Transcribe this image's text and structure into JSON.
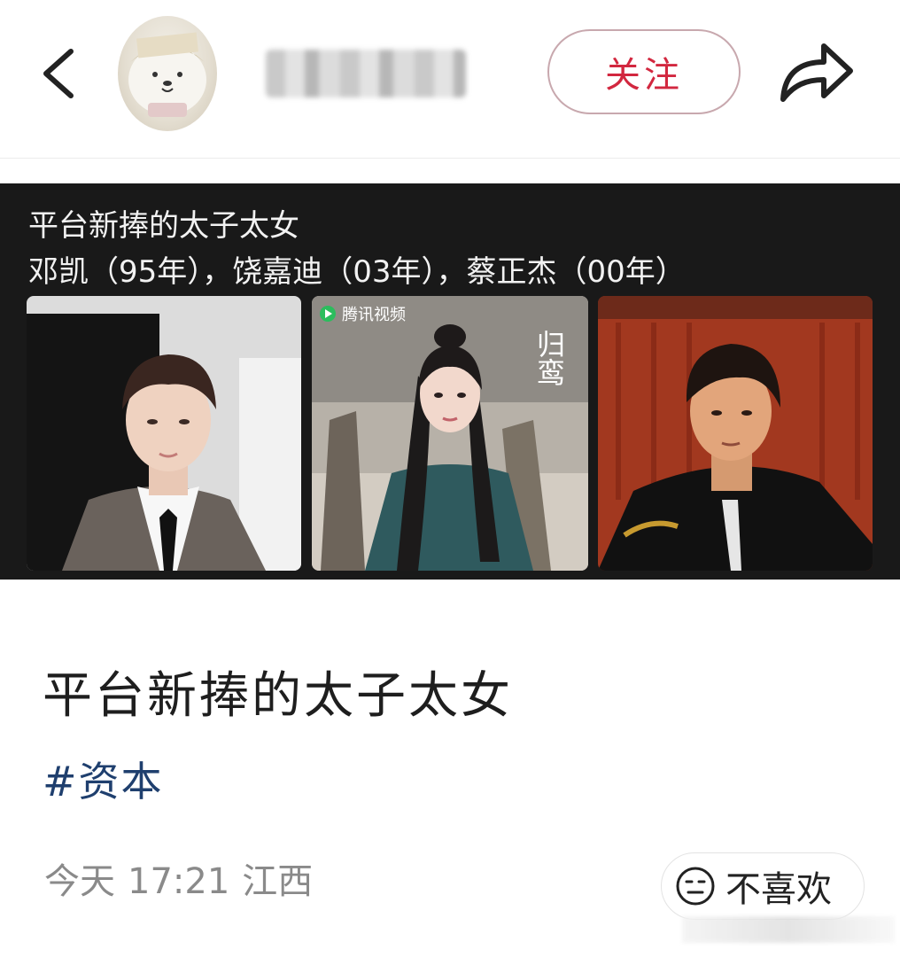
{
  "header": {
    "back_icon": "chevron-left-icon",
    "follow_label": "关注",
    "share_icon": "share-arrow-icon",
    "accent_color": "#d2273f"
  },
  "image_card": {
    "title": "平台新捧的太子太女",
    "subtitle": "邓凯（95年），饶嘉迪（03年），蔡正杰（00年）",
    "photo2_badge": "腾讯视频",
    "photo2_drama": "归鸾"
  },
  "post": {
    "title": "平台新捧的太子太女",
    "hashtag": "#资本",
    "date": "今天",
    "time": "17:21",
    "location": "江西",
    "dislike_label": "不喜欢",
    "dislike_icon": "unamused-face-icon"
  }
}
